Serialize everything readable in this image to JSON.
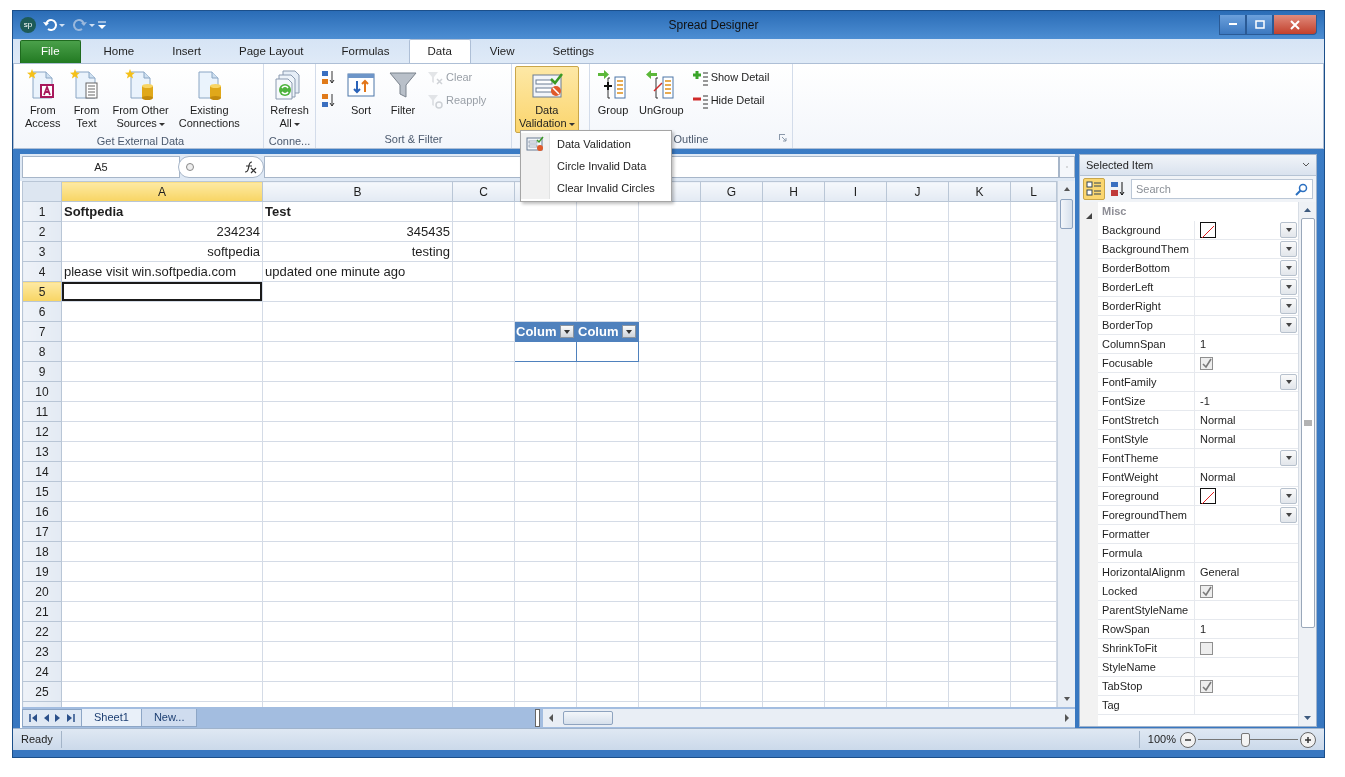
{
  "window": {
    "title": "Spread Designer",
    "app_badge": "sp"
  },
  "ribbon_tabs": [
    {
      "label": "File",
      "kind": "file",
      "selected": false
    },
    {
      "label": "Home",
      "kind": "tab",
      "selected": false
    },
    {
      "label": "Insert",
      "kind": "tab",
      "selected": false
    },
    {
      "label": "Page Layout",
      "kind": "tab",
      "selected": false
    },
    {
      "label": "Formulas",
      "kind": "tab",
      "selected": false
    },
    {
      "label": "Data",
      "kind": "tab",
      "selected": true
    },
    {
      "label": "View",
      "kind": "tab",
      "selected": false
    },
    {
      "label": "Settings",
      "kind": "tab",
      "selected": false
    }
  ],
  "ribbon_groups": [
    {
      "label": "Get External Data",
      "items": [
        {
          "kind": "large",
          "label": "From\nAccess",
          "dropdown": false,
          "pressed": false
        },
        {
          "kind": "large",
          "label": "From\nText",
          "dropdown": false,
          "pressed": false
        },
        {
          "kind": "large",
          "label": "From Other\nSources",
          "dropdown": true,
          "pressed": false
        },
        {
          "kind": "large",
          "label": "Existing\nConnections",
          "dropdown": false,
          "pressed": false
        }
      ]
    },
    {
      "label": "Conne...",
      "items": [
        {
          "kind": "large",
          "label": "Refresh\nAll",
          "dropdown": true,
          "pressed": false
        }
      ]
    },
    {
      "label": "Sort & Filter",
      "items": [
        {
          "kind": "stack",
          "items": [
            {
              "disabled": false
            },
            {
              "disabled": false
            }
          ]
        },
        {
          "kind": "large",
          "label": "Sort",
          "dropdown": false,
          "pressed": false
        },
        {
          "kind": "large",
          "label": "Filter",
          "dropdown": false,
          "pressed": false
        },
        {
          "kind": "stack",
          "items": [
            {
              "label": "Clear",
              "disabled": true
            },
            {
              "label": "Reapply",
              "disabled": true
            }
          ]
        }
      ]
    },
    {
      "items": [
        {
          "kind": "large",
          "label": "Data\nValidation",
          "dropdown": true,
          "pressed": true
        }
      ]
    },
    {
      "label": "Outline",
      "launcher": true,
      "items": [
        {
          "kind": "large",
          "label": "Group",
          "dropdown": false,
          "pressed": false
        },
        {
          "kind": "large",
          "label": "UnGroup",
          "dropdown": false,
          "pressed": false
        },
        {
          "kind": "stack",
          "items": [
            {
              "label": "Show Detail",
              "disabled": false
            },
            {
              "label": "Hide Detail",
              "disabled": false
            }
          ]
        }
      ]
    }
  ],
  "dropdown_menu": {
    "items": [
      {
        "label": "Data Validation",
        "icon": true
      },
      {
        "label": "Circle Invalid Data",
        "icon": false
      },
      {
        "label": "Clear Invalid Circles",
        "icon": false
      }
    ]
  },
  "formula_bar": {
    "name_box": "A5"
  },
  "sheet": {
    "columns": [
      {
        "label": "A",
        "selected": true
      },
      {
        "label": "B",
        "selected": false
      },
      {
        "label": "C",
        "selected": false
      },
      {},
      {},
      {
        "selected": false
      },
      {
        "label": "G",
        "selected": false
      },
      {
        "label": "H",
        "selected": false
      },
      {
        "label": "I",
        "selected": false
      },
      {
        "label": "J",
        "selected": false
      },
      {
        "label": "K",
        "selected": false
      },
      {
        "label": "L",
        "selected": false
      }
    ],
    "rows": [
      {
        "header": "1",
        "selected": false,
        "cells": [
          {
            "text": "Softpedia",
            "bold": true
          },
          {
            "text": "Test",
            "bold": true
          }
        ]
      },
      {
        "header": "2",
        "selected": false,
        "cells": [
          {
            "text": "234234",
            "right_aligned": true
          },
          {
            "text": "345435",
            "right_aligned": true
          }
        ]
      },
      {
        "header": "3",
        "selected": false,
        "cells": [
          {
            "text": "softpedia",
            "right_aligned": true
          },
          {
            "text": "testing",
            "right_aligned": true
          }
        ]
      },
      {
        "header": "4",
        "selected": false,
        "cells": [
          {
            "text": "please visit win.softpedia.com"
          },
          {
            "text": "updated one minute ago"
          }
        ]
      },
      {
        "header": "5",
        "selected": true,
        "cells": [
          {
            "active": true
          }
        ]
      },
      {
        "header": "6",
        "selected": false,
        "cells": []
      },
      {
        "header": "7",
        "selected": false,
        "cells": [
          {},
          {},
          {},
          {
            "kind": "table-header",
            "text": "Colum"
          },
          {
            "kind": "table-header",
            "text": "Colum"
          }
        ]
      },
      {
        "header": "8",
        "selected": false,
        "cells": [
          {},
          {},
          {},
          {
            "kind": "table-body"
          },
          {
            "kind": "table-body"
          }
        ]
      },
      {
        "header": "9",
        "selected": false,
        "cells": []
      },
      {
        "header": "10",
        "selected": false,
        "cells": []
      },
      {
        "header": "11",
        "selected": false,
        "cells": []
      },
      {
        "header": "12",
        "selected": false,
        "cells": []
      },
      {
        "header": "13",
        "selected": false,
        "cells": []
      },
      {
        "header": "14",
        "selected": false,
        "cells": []
      },
      {
        "header": "15",
        "selected": false,
        "cells": []
      },
      {
        "header": "16",
        "selected": false,
        "cells": []
      },
      {
        "header": "17",
        "selected": false,
        "cells": []
      },
      {
        "header": "18",
        "selected": false,
        "cells": []
      },
      {
        "header": "19",
        "selected": false,
        "cells": []
      },
      {
        "header": "20",
        "selected": false,
        "cells": []
      },
      {
        "header": "21",
        "selected": false,
        "cells": []
      },
      {
        "header": "22",
        "selected": false,
        "cells": []
      },
      {
        "header": "23",
        "selected": false,
        "cells": []
      },
      {
        "header": "24",
        "selected": false,
        "cells": []
      },
      {
        "header": "25",
        "selected": false,
        "cells": []
      }
    ]
  },
  "sheet_tabs": [
    {
      "label": "Sheet1",
      "selected": true
    },
    {
      "label": "New...",
      "selected": false
    }
  ],
  "properties_panel": {
    "title": "Selected Item",
    "categorized_selected": true,
    "search_placeholder": "Search",
    "category": {
      "label": "Misc",
      "expanded": true
    },
    "rows": [
      {
        "name": "Background",
        "kind": "color",
        "dropdown": true
      },
      {
        "name": "BackgroundThem",
        "kind": "text",
        "dropdown": true
      },
      {
        "name": "BorderBottom",
        "kind": "text",
        "dropdown": true
      },
      {
        "name": "BorderLeft",
        "kind": "text",
        "dropdown": true
      },
      {
        "name": "BorderRight",
        "kind": "text",
        "dropdown": true
      },
      {
        "name": "BorderTop",
        "kind": "text",
        "dropdown": true
      },
      {
        "name": "ColumnSpan",
        "kind": "text",
        "value": "1",
        "dropdown": false
      },
      {
        "name": "Focusable",
        "kind": "check",
        "checked": true,
        "dropdown": false
      },
      {
        "name": "FontFamily",
        "kind": "text",
        "dropdown": true
      },
      {
        "name": "FontSize",
        "kind": "text",
        "value": "-1",
        "dropdown": false
      },
      {
        "name": "FontStretch",
        "kind": "text",
        "value": "Normal",
        "dropdown": false
      },
      {
        "name": "FontStyle",
        "kind": "text",
        "value": "Normal",
        "dropdown": false
      },
      {
        "name": "FontTheme",
        "kind": "text",
        "dropdown": true
      },
      {
        "name": "FontWeight",
        "kind": "text",
        "value": "Normal",
        "dropdown": false
      },
      {
        "name": "Foreground",
        "kind": "color",
        "dropdown": true
      },
      {
        "name": "ForegroundThem",
        "kind": "text",
        "dropdown": true
      },
      {
        "name": "Formatter",
        "kind": "text",
        "dropdown": false
      },
      {
        "name": "Formula",
        "kind": "text",
        "dropdown": false
      },
      {
        "name": "HorizontalAlignm",
        "kind": "text",
        "value": "General",
        "dropdown": false
      },
      {
        "name": "Locked",
        "kind": "check",
        "checked": true,
        "dropdown": false
      },
      {
        "name": "ParentStyleName",
        "kind": "text",
        "dropdown": false
      },
      {
        "name": "RowSpan",
        "kind": "text",
        "value": "1",
        "dropdown": false
      },
      {
        "name": "ShrinkToFit",
        "kind": "check",
        "checked": false,
        "dropdown": false
      },
      {
        "name": "StyleName",
        "kind": "text",
        "dropdown": false
      },
      {
        "name": "TabStop",
        "kind": "check",
        "checked": true,
        "dropdown": false
      },
      {
        "name": "Tag",
        "kind": "text",
        "dropdown": false
      }
    ]
  },
  "status_bar": {
    "text": "Ready",
    "zoom": "100%",
    "zoom_slider": {
      "level": 0.47
    }
  }
}
